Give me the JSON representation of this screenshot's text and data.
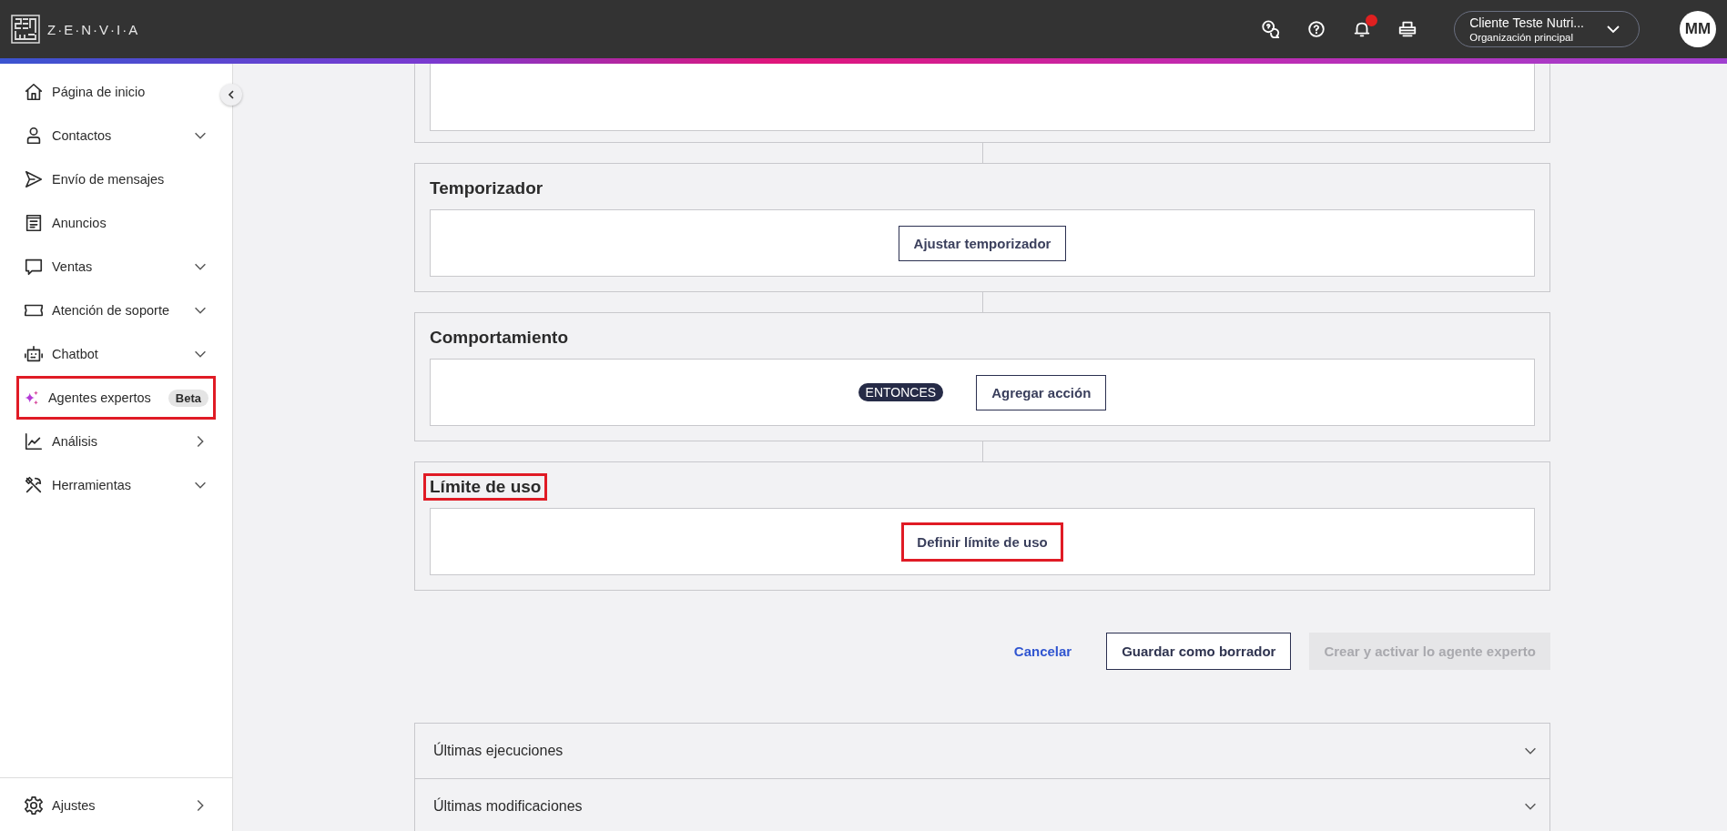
{
  "header": {
    "logo_text": "Z·E·N·V·I·A",
    "has_notifications": true,
    "org": {
      "name": "Cliente Teste Nutri...",
      "subtitle": "Organización principal"
    },
    "avatar": "MM"
  },
  "sidebar": {
    "items": [
      {
        "label": "Página de inicio",
        "highlighted": false
      },
      {
        "label": "Contactos",
        "highlighted": false
      },
      {
        "label": "Envío de mensajes",
        "highlighted": false
      },
      {
        "label": "Anuncios",
        "highlighted": false
      },
      {
        "label": "Ventas",
        "highlighted": false
      },
      {
        "label": "Atención de soporte",
        "highlighted": false
      },
      {
        "label": "Chatbot",
        "highlighted": false
      },
      {
        "label": "Agentes expertos",
        "badge": "Beta",
        "highlighted": true
      },
      {
        "label": "Análisis",
        "highlighted": false
      },
      {
        "label": "Herramientas",
        "highlighted": false
      }
    ],
    "footer": {
      "label": "Ajustes",
      "highlighted": false
    }
  },
  "cards": [
    {
      "title": "Temporizador",
      "title_highlighted": false,
      "kind": "button",
      "button": "Ajustar temporizador",
      "button_highlighted": false
    },
    {
      "title": "Comportamiento",
      "title_highlighted": false,
      "kind": "then-action",
      "tag": "ENTONCES",
      "button": "Agregar acción",
      "button_highlighted": false
    },
    {
      "title": "Límite de uso",
      "title_highlighted": true,
      "kind": "button",
      "button": "Definir límite de uso",
      "button_highlighted": true
    }
  ],
  "actions": [
    {
      "label": "Cancelar",
      "kind": "link",
      "disabled": false
    },
    {
      "label": "Guardar como borrador",
      "kind": "outline",
      "disabled": false
    },
    {
      "label": "Crear y activar lo agente experto",
      "kind": "solid",
      "disabled": true
    }
  ],
  "accordions": [
    {
      "label": "Últimas ejecuciones",
      "expanded": false
    },
    {
      "label": "Últimas modificaciones",
      "expanded": false
    }
  ]
}
